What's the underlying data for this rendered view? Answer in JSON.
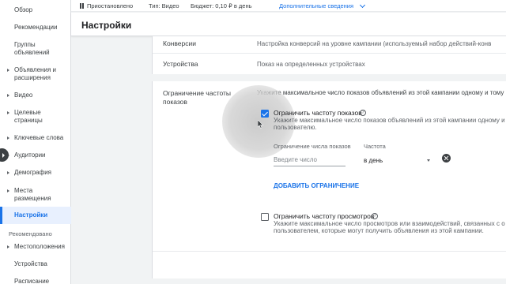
{
  "sidebar": {
    "items": [
      {
        "label": "Обзор",
        "arrow": false
      },
      {
        "label": "Рекомендации",
        "arrow": false
      },
      {
        "label": "Группы объявлений",
        "arrow": false
      },
      {
        "label": "Объявления и расширения",
        "arrow": true
      },
      {
        "label": "Видео",
        "arrow": true
      },
      {
        "label": "Целевые страницы",
        "arrow": true
      },
      {
        "label": "Ключевые слова",
        "arrow": true
      },
      {
        "label": "Аудитории",
        "arrow": true
      },
      {
        "label": "Демография",
        "arrow": true
      },
      {
        "label": "Места размещения",
        "arrow": true
      },
      {
        "label": "Настройки",
        "arrow": false,
        "active": true
      },
      {
        "label": "Местоположения",
        "arrow": true
      },
      {
        "label": "Устройства",
        "arrow": false
      },
      {
        "label": "Расписание",
        "arrow": false
      }
    ],
    "section_label": "Рекомендовано"
  },
  "statusbar": {
    "status": "Приостановлено",
    "type": "Тип: Видео",
    "budget": "Бюджет: 0,10 ₽ в день",
    "details_link": "Дополнительные сведения"
  },
  "page": {
    "title": "Настройки"
  },
  "settings": {
    "conversions": {
      "label": "Конверсии",
      "value": "Настройка конверсий на уровне кампании (используемый набор действий-конв"
    },
    "devices": {
      "label": "Устройства",
      "value": "Показ на определенных устройствах"
    },
    "frequency": {
      "label": "Ограничение частоты показов",
      "description": "Укажите максимальное число показов объявлений из этой кампании одному и тому",
      "impressions": {
        "checkbox_label": "Ограничить частоту показов",
        "checked": true,
        "description_line1": "Укажите максимальное число показов объявлений из этой кампании одному и",
        "description_line2": "пользователю.",
        "limit_column": "Ограничение числа показов",
        "frequency_column": "Частота",
        "limit_placeholder": "Введите число",
        "frequency_value": "в день",
        "add_limit": "ДОБАВИТЬ ОГРАНИЧЕНИЕ"
      },
      "views": {
        "checkbox_label": "Ограничить частоту просмотров",
        "checked": false,
        "description_line1": "Укажите максимальное число просмотров или взаимодействий, связанных с о",
        "description_line2": "пользователем, которые могут получить объявления из этой кампании."
      }
    }
  },
  "colors": {
    "accent": "#1a73e8",
    "active_bg": "#e8f0fe"
  }
}
